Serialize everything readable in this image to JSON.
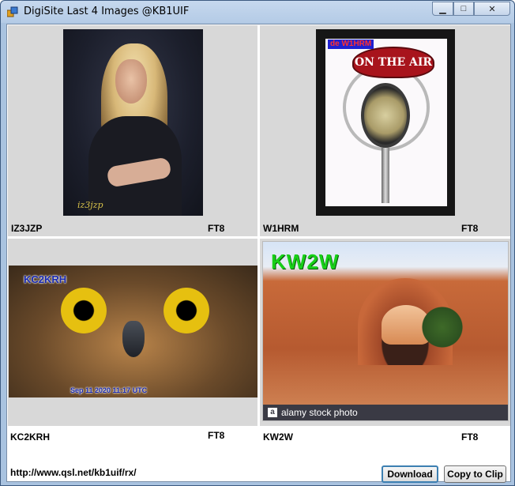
{
  "window": {
    "title": "DigiSite Last 4 Images @KB1UIF",
    "controls": {
      "minimize": "▁",
      "maximize": "□",
      "close": "✕"
    }
  },
  "images": [
    {
      "callsign": "IZ3JZP",
      "mode": "FT8",
      "overlay_text": "iz3jzp"
    },
    {
      "callsign": "W1HRM",
      "mode": "FT8",
      "overlay_text": "de W1HRM",
      "badge_text": "ON THE AIR"
    },
    {
      "callsign": "KC2KRH",
      "mode": "FT8",
      "overlay_text": "KC2KRH",
      "timestamp": "Sep 11 2020 11:17 UTC"
    },
    {
      "callsign": "KW2W",
      "mode": "FT8",
      "overlay_text": "KW2W",
      "watermark": "alamy stock photo"
    }
  ],
  "footer": {
    "url": "http://www.qsl.net/kb1uif/rx/",
    "download_label": "Download",
    "copy_label": "Copy to Clip"
  },
  "icons": {
    "app": "app-icon",
    "minimize": "minimize-icon",
    "maximize": "maximize-icon",
    "close": "close-icon"
  },
  "colors": {
    "titlebar": "#b4cbe6",
    "panel": "#d8d8d8",
    "download_focus": "#3c7fb1"
  }
}
